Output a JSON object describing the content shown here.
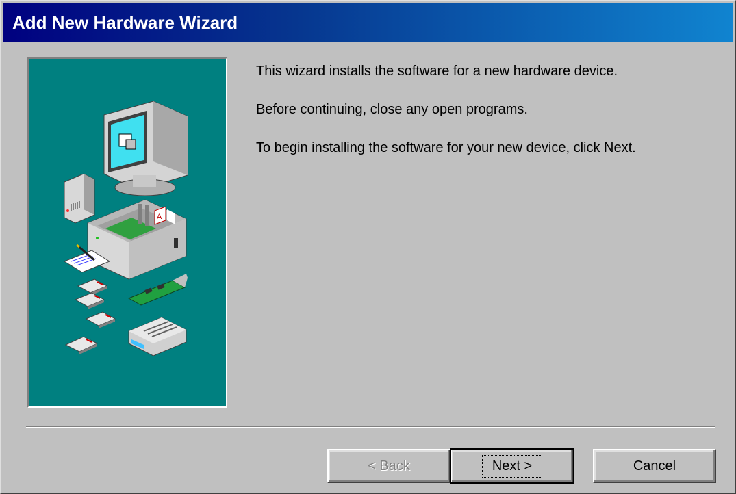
{
  "window": {
    "title": "Add New Hardware Wizard"
  },
  "content": {
    "paragraphs": [
      "This wizard installs the software for a new hardware device.",
      "Before continuing, close any open programs.",
      "To begin installing the software for your new device, click Next."
    ]
  },
  "buttons": {
    "back_label": "< Back",
    "next_label": "Next >",
    "cancel_label": "Cancel"
  },
  "colors": {
    "titlebar_start": "#000080",
    "titlebar_end": "#1084d0",
    "illustration_bg": "#008080",
    "dialog_bg": "#c0c0c0"
  },
  "icons": [
    "monitor-icon",
    "speaker-icon",
    "computer-case-icon",
    "notepad-icon",
    "floppy-disk-icon",
    "expansion-card-icon",
    "modem-icon"
  ]
}
